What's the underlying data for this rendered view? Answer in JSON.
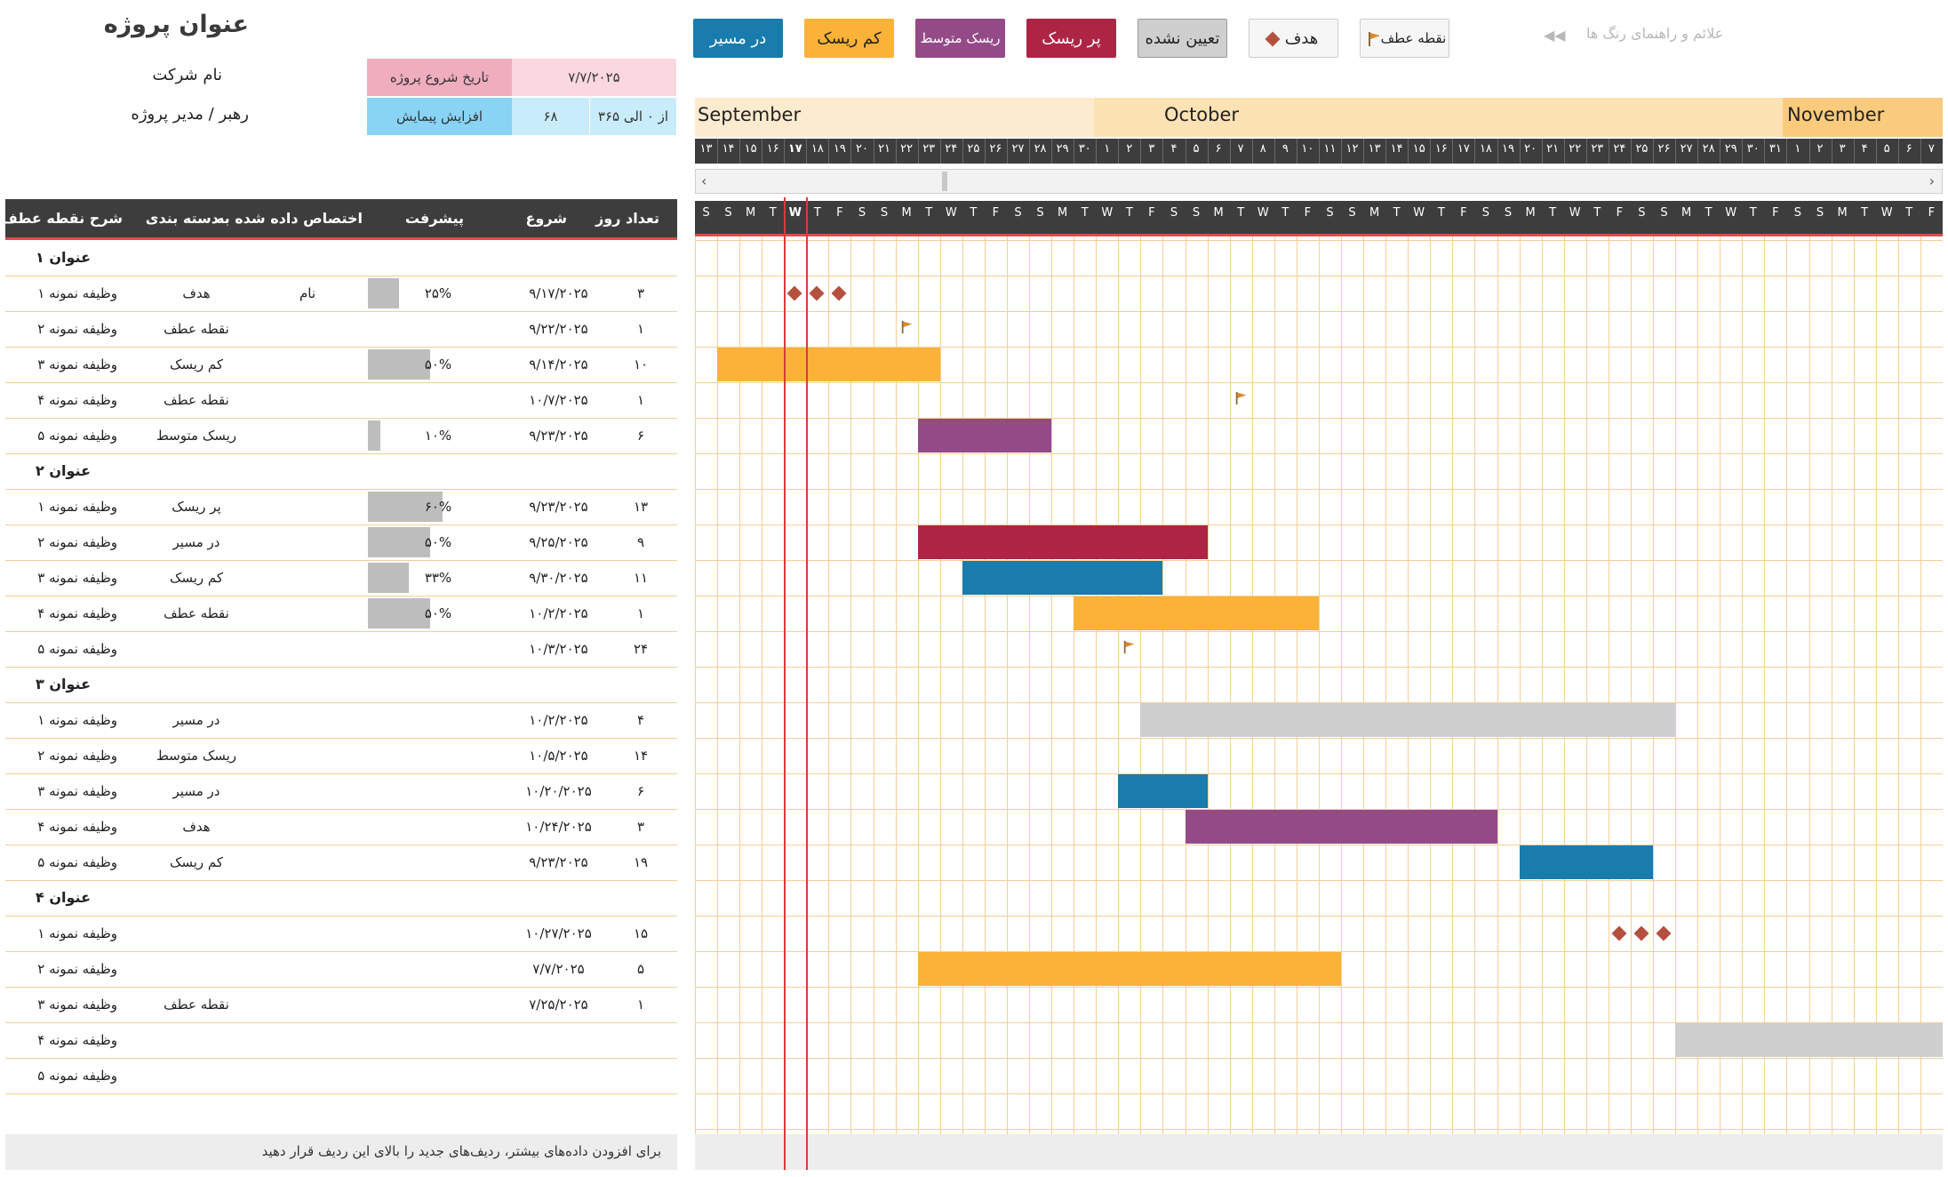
{
  "project": {
    "title": "عنوان پروژه",
    "company": "نام شرکت",
    "manager": "رهبر / مدیر  پروژه",
    "start_label": "تاریخ شروع پروژه",
    "start_value": "۷/۷/۲۰۲۵",
    "scroll_label": "افزایش پیمایش",
    "scroll_value": "۶۸",
    "scroll_range": "از ۰ الی ۳۶۵"
  },
  "legend": {
    "hint": "علائم و راهنمای رنگ ها",
    "items": [
      {
        "label": "در مسیر",
        "color": "#1a7bad"
      },
      {
        "label": "کم ریسک",
        "color": "#fab238"
      },
      {
        "label": "ریسک متوسط",
        "color": "#944a87"
      },
      {
        "label": "پر ریسک",
        "color": "#ad2444"
      },
      {
        "label": "تعیین نشده",
        "color": "#cfcfcf"
      },
      {
        "label": "هدف",
        "color": "#b5503e"
      },
      {
        "label": "نقطه عطف",
        "color": "#d88a2b"
      }
    ]
  },
  "table": {
    "headers": {
      "days": "تعداد روز",
      "start": "شروع",
      "progress": "پیشرفت",
      "assigned": "اختصاص داده شده به",
      "category": "دسته بندی",
      "description": "شرح نقطه عطف"
    },
    "sections": [
      {
        "title": "عنوان ۱",
        "rows": [
          {
            "desc": "وظیفه نمونه ۱",
            "category": "هدف",
            "assigned": "نام",
            "progress": "۲۵%",
            "progress_value": 25,
            "start": "۹/۱۷/۲۰۲۵",
            "days": "۳"
          },
          {
            "desc": "وظیفه نمونه ۲",
            "category": "نقطه عطف",
            "assigned": "",
            "progress": "",
            "progress_value": 0,
            "start": "۹/۲۲/۲۰۲۵",
            "days": "۱"
          },
          {
            "desc": "وظیفه نمونه ۳",
            "category": "کم ریسک",
            "assigned": "",
            "progress": "۵۰%",
            "progress_value": 50,
            "start": "۹/۱۴/۲۰۲۵",
            "days": "۱۰"
          },
          {
            "desc": "وظیفه نمونه ۴",
            "category": "نقطه عطف",
            "assigned": "",
            "progress": "",
            "progress_value": 0,
            "start": "۱۰/۷/۲۰۲۵",
            "days": "۱"
          },
          {
            "desc": "وظیفه نمونه ۵",
            "category": "ریسک متوسط",
            "assigned": "",
            "progress": "۱۰%",
            "progress_value": 10,
            "start": "۹/۲۳/۲۰۲۵",
            "days": "۶"
          }
        ]
      },
      {
        "title": "عنوان ۲",
        "rows": [
          {
            "desc": "وظیفه نمونه ۱",
            "category": "پر ریسک",
            "assigned": "",
            "progress": "۶۰%",
            "progress_value": 60,
            "start": "۹/۲۳/۲۰۲۵",
            "days": "۱۳"
          },
          {
            "desc": "وظیفه نمونه ۲",
            "category": "در مسیر",
            "assigned": "",
            "progress": "۵۰%",
            "progress_value": 50,
            "start": "۹/۲۵/۲۰۲۵",
            "days": "۹"
          },
          {
            "desc": "وظیفه نمونه ۳",
            "category": "کم ریسک",
            "assigned": "",
            "progress": "۳۳%",
            "progress_value": 33,
            "start": "۹/۳۰/۲۰۲۵",
            "days": "۱۱"
          },
          {
            "desc": "وظیفه نمونه ۴",
            "category": "نقطه عطف",
            "assigned": "",
            "progress": "۵۰%",
            "progress_value": 50,
            "start": "۱۰/۲/۲۰۲۵",
            "days": "۱"
          },
          {
            "desc": "وظیفه نمونه ۵",
            "category": "",
            "assigned": "",
            "progress": "",
            "progress_value": 0,
            "start": "۱۰/۳/۲۰۲۵",
            "days": "۲۴"
          }
        ]
      },
      {
        "title": "عنوان ۳",
        "rows": [
          {
            "desc": "وظیفه نمونه ۱",
            "category": "در مسیر",
            "assigned": "",
            "progress": "",
            "progress_value": 0,
            "start": "۱۰/۲/۲۰۲۵",
            "days": "۴"
          },
          {
            "desc": "وظیفه نمونه ۲",
            "category": "ریسک متوسط",
            "assigned": "",
            "progress": "",
            "progress_value": 0,
            "start": "۱۰/۵/۲۰۲۵",
            "days": "۱۴"
          },
          {
            "desc": "وظیفه نمونه ۳",
            "category": "در مسیر",
            "assigned": "",
            "progress": "",
            "progress_value": 0,
            "start": "۱۰/۲۰/۲۰۲۵",
            "days": "۶"
          },
          {
            "desc": "وظیفه نمونه ۴",
            "category": "هدف",
            "assigned": "",
            "progress": "",
            "progress_value": 0,
            "start": "۱۰/۲۴/۲۰۲۵",
            "days": "۳"
          },
          {
            "desc": "وظیفه نمونه ۵",
            "category": "کم ریسک",
            "assigned": "",
            "progress": "",
            "progress_value": 0,
            "start": "۹/۲۳/۲۰۲۵",
            "days": "۱۹"
          }
        ]
      },
      {
        "title": "عنوان ۴",
        "rows": [
          {
            "desc": "وظیفه نمونه ۱",
            "category": "",
            "assigned": "",
            "progress": "",
            "progress_value": 0,
            "start": "۱۰/۲۷/۲۰۲۵",
            "days": "۱۵"
          },
          {
            "desc": "وظیفه نمونه ۲",
            "category": "",
            "assigned": "",
            "progress": "",
            "progress_value": 0,
            "start": "۷/۷/۲۰۲۵",
            "days": "۵"
          },
          {
            "desc": "وظیفه نمونه ۳",
            "category": "نقطه عطف",
            "assigned": "",
            "progress": "",
            "progress_value": 0,
            "start": "۷/۲۵/۲۰۲۵",
            "days": "۱"
          },
          {
            "desc": "وظیفه نمونه ۴",
            "category": "",
            "assigned": "",
            "progress": "",
            "progress_value": 0,
            "start": "",
            "days": ""
          },
          {
            "desc": "وظیفه نمونه ۵",
            "category": "",
            "assigned": "",
            "progress": "",
            "progress_value": 0,
            "start": "",
            "days": ""
          }
        ]
      }
    ],
    "footer": "برای افزودن داده‌های بیشتر، ردیف‌های جدید را بالای این ردیف قرار دهید"
  },
  "timeline": {
    "months": [
      {
        "label": "September",
        "color": "#fdebd0"
      },
      {
        "label": "October",
        "color": "#fde2b4"
      },
      {
        "label": "November",
        "color": "#fbcb7d"
      }
    ],
    "dates": [
      "۱۳",
      "۱۴",
      "۱۵",
      "۱۶",
      "۱۷",
      "۱۸",
      "۱۹",
      "۲۰",
      "۲۱",
      "۲۲",
      "۲۳",
      "۲۴",
      "۲۵",
      "۲۶",
      "۲۷",
      "۲۸",
      "۲۹",
      "۳۰",
      "۱",
      "۲",
      "۳",
      "۴",
      "۵",
      "۶",
      "۷",
      "۸",
      "۹",
      "۱۰",
      "۱۱",
      "۱۲",
      "۱۳",
      "۱۴",
      "۱۵",
      "۱۶",
      "۱۷",
      "۱۸",
      "۱۹",
      "۲۰",
      "۲۱",
      "۲۲",
      "۲۳",
      "۲۴",
      "۲۵",
      "۲۶",
      "۲۷",
      "۲۸",
      "۲۹",
      "۳۰",
      "۳۱",
      "۱",
      "۲",
      "۳",
      "۴",
      "۵",
      "۶",
      "۷"
    ],
    "weekdays": [
      "S",
      "S",
      "M",
      "T",
      "W",
      "T",
      "F",
      "S",
      "S",
      "M",
      "T",
      "W",
      "T",
      "F",
      "S",
      "S",
      "M",
      "T",
      "W",
      "T",
      "F",
      "S",
      "S",
      "M",
      "T",
      "W",
      "T",
      "F",
      "S",
      "S",
      "M",
      "T",
      "W",
      "T",
      "F",
      "S",
      "S",
      "M",
      "T",
      "W",
      "T",
      "F",
      "S",
      "S",
      "M",
      "T",
      "W",
      "T",
      "F",
      "S",
      "S",
      "M",
      "T",
      "W",
      "T",
      "F"
    ],
    "today_index": 4,
    "bars": [
      {
        "row": 2,
        "start": 1,
        "days": 10,
        "color": "#fab238"
      },
      {
        "row": 4,
        "start": 10,
        "days": 6,
        "color": "#944a87"
      },
      {
        "row": 6,
        "start": 10,
        "days": 13,
        "color": "#ad2444"
      },
      {
        "row": 7,
        "start": 12,
        "days": 9,
        "color": "#1a7bad"
      },
      {
        "row": 8,
        "start": 17,
        "days": 11,
        "color": "#fab238"
      },
      {
        "row": 10,
        "start": 20,
        "days": 24,
        "color": "#cfcfcf"
      },
      {
        "row": 12,
        "start": 19,
        "days": 4,
        "color": "#1a7bad"
      },
      {
        "row": 13,
        "start": 22,
        "days": 14,
        "color": "#944a87"
      },
      {
        "row": 14,
        "start": 37,
        "days": 6,
        "color": "#1a7bad"
      },
      {
        "row": 16,
        "start": 10,
        "days": 19,
        "color": "#fab238"
      },
      {
        "row": 18,
        "start": 44,
        "days": 12,
        "color": "#cfcfcf"
      }
    ],
    "goals": [
      {
        "row": 0,
        "start": 4,
        "days": 3
      },
      {
        "row": 15,
        "start": 41,
        "days": 3
      }
    ],
    "milestones": [
      {
        "row": 1,
        "start": 9
      },
      {
        "row": 3,
        "start": 24
      },
      {
        "row": 9,
        "start": 19
      }
    ]
  }
}
